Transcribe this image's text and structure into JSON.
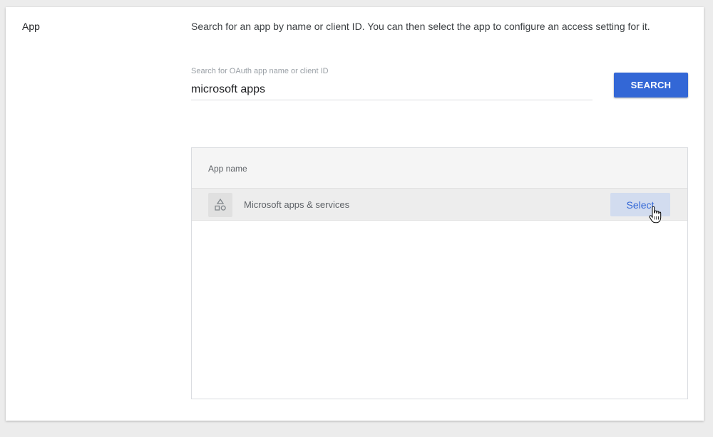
{
  "app_section": {
    "label": "App",
    "description": "Search for an app by name or client ID. You can then select the app to configure an access setting for it."
  },
  "search": {
    "label": "Search for OAuth app name or client ID",
    "value": "microsoft apps",
    "button_label": "SEARCH"
  },
  "results_table": {
    "column_header": "App name",
    "rows": [
      {
        "icon": "shapes-icon",
        "name": "Microsoft apps & services",
        "action_label": "Select"
      }
    ]
  },
  "colors": {
    "primary": "#3367d6",
    "select_bg": "#d2dcef",
    "row_hover_bg": "#ededed",
    "header_bg": "#f5f5f5",
    "page_bg": "#ececec"
  }
}
